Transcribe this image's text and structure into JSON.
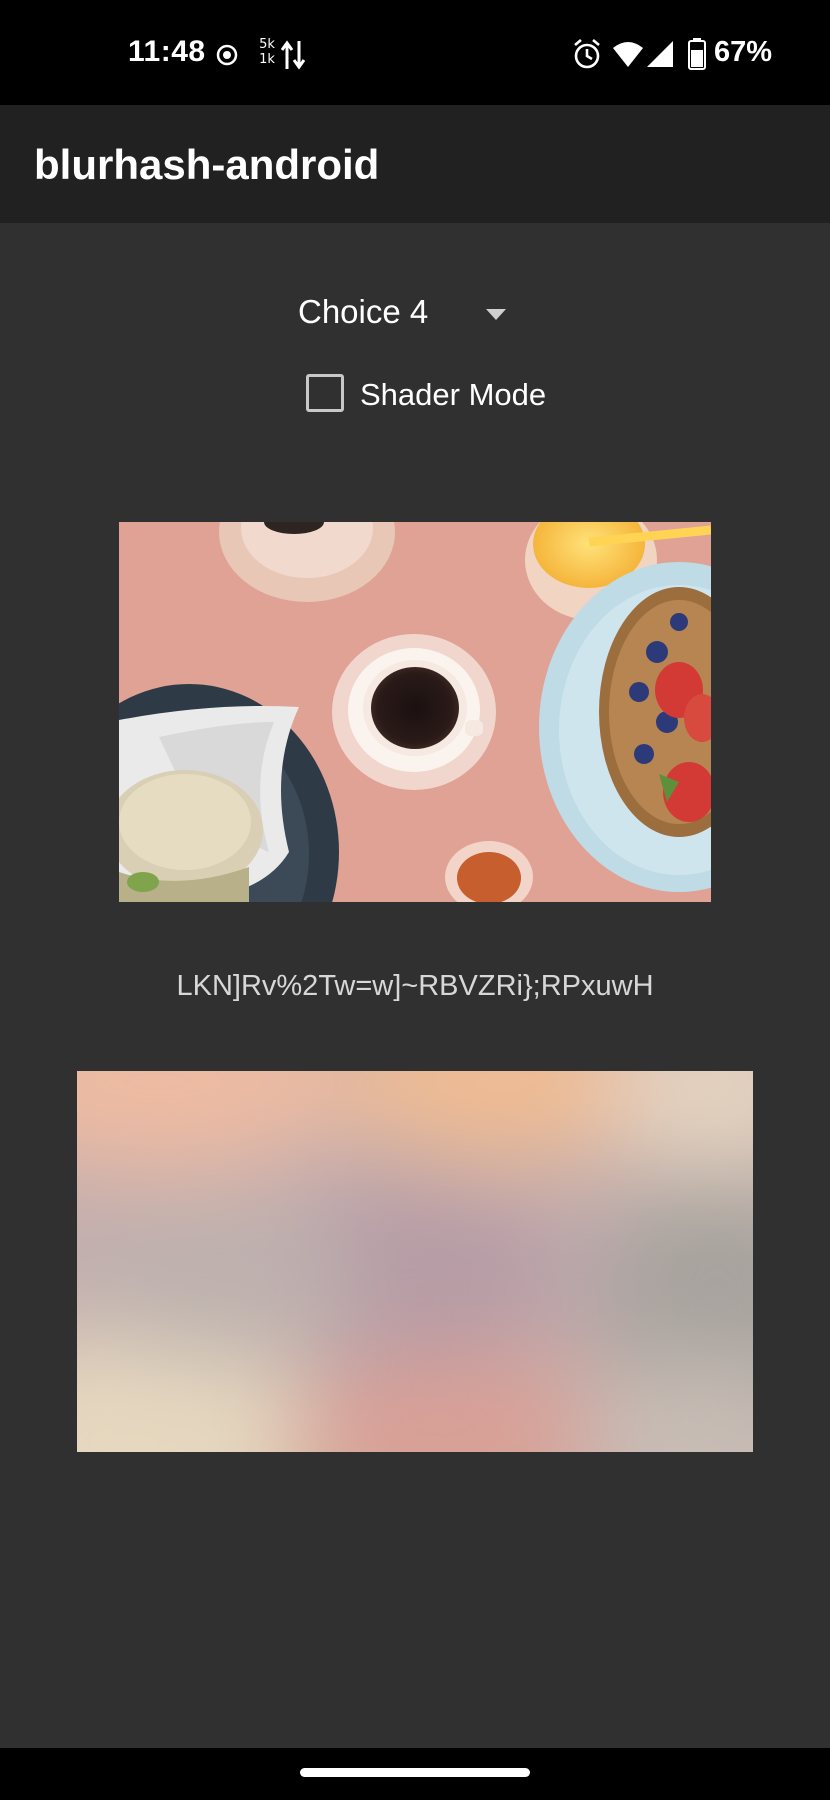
{
  "status_bar": {
    "time": "11:48",
    "data_rate_up": "5k",
    "data_rate_down": "1k",
    "battery": "67%",
    "icons": [
      "dnd-icon",
      "data-transfer-icon",
      "alarm-icon",
      "wifi-icon",
      "signal-icon",
      "battery-icon"
    ]
  },
  "app_bar": {
    "title": "blurhash-android"
  },
  "controls": {
    "spinner_value": "Choice 4",
    "checkbox_label": "Shader Mode",
    "checkbox_checked": false
  },
  "content": {
    "hash": "LKN]Rv%2Tw=w]~RBVZRi};RPxuwH"
  },
  "colors": {
    "background": "#303030",
    "app_bar": "#212121",
    "status_bar": "#000000",
    "photo_background": "#dfa295"
  }
}
